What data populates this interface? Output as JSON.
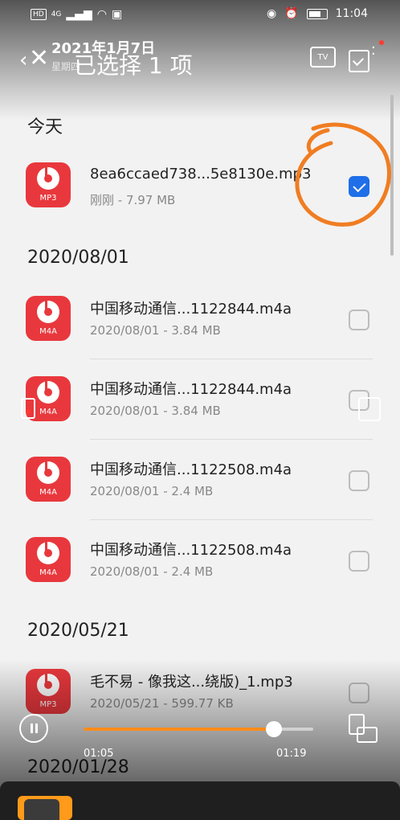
{
  "status_bar": {
    "network_badge": "HD",
    "signal_label": "4G",
    "time": "11:04"
  },
  "overlay": {
    "date": "2021年1月7日",
    "weekday": "星期四"
  },
  "header": {
    "title": "已选择 1 项",
    "tv_label": "TV"
  },
  "sections": [
    {
      "title": "今天"
    },
    {
      "title": "2020/08/01"
    },
    {
      "title": "2020/05/21"
    },
    {
      "title": "2020/01/28"
    }
  ],
  "files": [
    {
      "name": "8ea6ccaed738...5e8130e.mp3",
      "meta": "刚刚 - 7.97 MB",
      "ext": "MP3",
      "checked": true
    },
    {
      "name": "中国移动通信...1122844.m4a",
      "meta": "2020/08/01 - 3.84 MB",
      "ext": "M4A",
      "checked": false
    },
    {
      "name": "中国移动通信...1122844.m4a",
      "meta": "2020/08/01 - 3.84 MB",
      "ext": "M4A",
      "checked": false
    },
    {
      "name": "中国移动通信...1122508.m4a",
      "meta": "2020/08/01 - 2.4 MB",
      "ext": "M4A",
      "checked": false
    },
    {
      "name": "中国移动通信...1122508.m4a",
      "meta": "2020/08/01 - 2.4 MB",
      "ext": "M4A",
      "checked": false
    },
    {
      "name": "毛不易 - 像我这...绕版)_1.mp3",
      "meta": "2020/05/21 - 599.77 KB",
      "ext": "MP3",
      "checked": false
    }
  ],
  "player": {
    "elapsed": "01:05",
    "total": "01:19",
    "progress": 0.83
  },
  "colors": {
    "accent": "#1e6fe8",
    "file_icon": "#e8383d",
    "progress": "#ff8c1a",
    "annotation": "#f07d22"
  }
}
